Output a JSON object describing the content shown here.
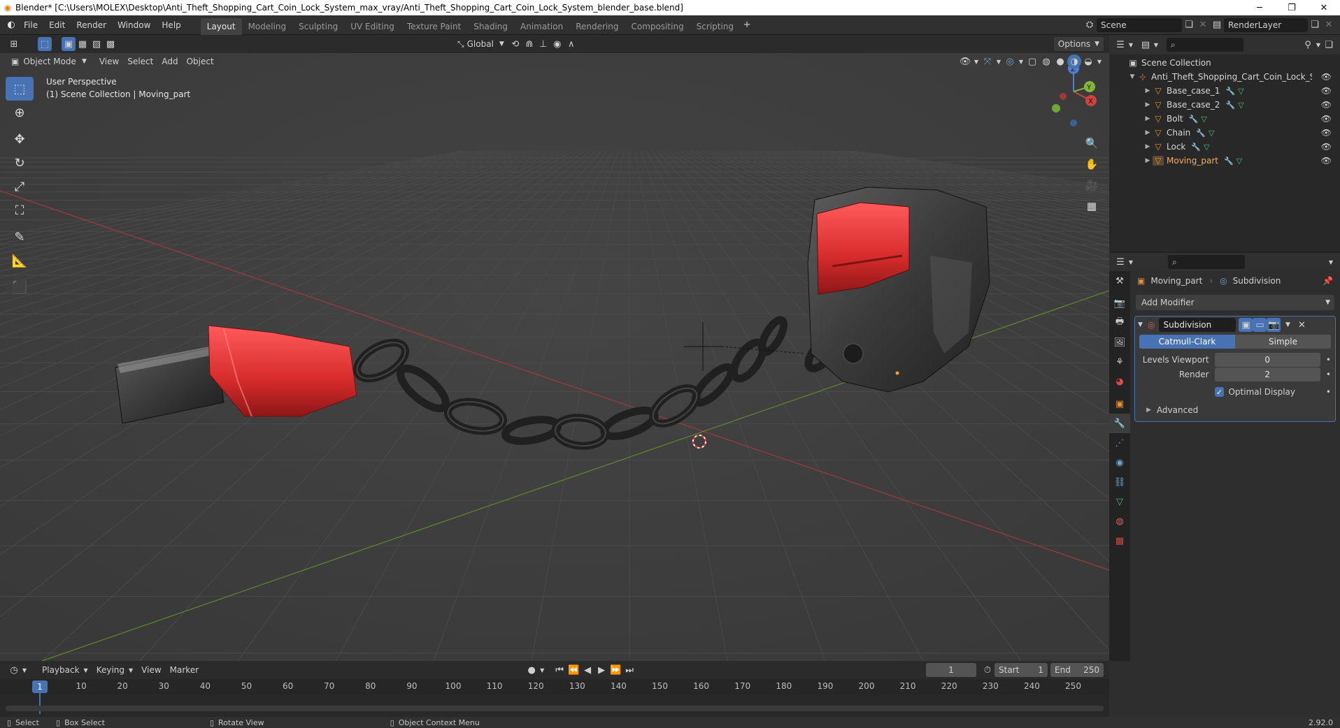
{
  "window": {
    "title": "Blender* [C:\\Users\\MOLEX\\Desktop\\Anti_Theft_Shopping_Cart_Coin_Lock_System_max_vray/Anti_Theft_Shopping_Cart_Coin_Lock_System_blender_base.blend]",
    "controls": [
      "─",
      "❐",
      "✕"
    ]
  },
  "menu": [
    "File",
    "Edit",
    "Render",
    "Window",
    "Help"
  ],
  "workspaces": [
    "Layout",
    "Modeling",
    "Sculpting",
    "UV Editing",
    "Texture Paint",
    "Shading",
    "Animation",
    "Rendering",
    "Compositing",
    "Scripting"
  ],
  "active_workspace": "Layout",
  "scene_field": "Scene",
  "renderlayer_field": "RenderLayer",
  "viewport": {
    "mode": "Object Mode",
    "menus": [
      "View",
      "Select",
      "Add",
      "Object"
    ],
    "transform_orientation": "Global",
    "options_label": "Options",
    "info_line1": "User Perspective",
    "info_line2": "(1) Scene Collection | Moving_part",
    "gizmo_axes": {
      "x": "X",
      "y": "Y",
      "z": "Z"
    }
  },
  "outliner": {
    "root": "Scene Collection",
    "collection": "Anti_Theft_Shopping_Cart_Coin_Lock_Syster",
    "objects": [
      "Base_case_1",
      "Base_case_2",
      "Bolt",
      "Chain",
      "Lock",
      "Moving_part"
    ]
  },
  "properties": {
    "breadcrumb_object": "Moving_part",
    "breadcrumb_modifier": "Subdivision",
    "add_modifier": "Add Modifier",
    "modifier_name": "Subdivision",
    "mode_catmull": "Catmull-Clark",
    "mode_simple": "Simple",
    "levels_viewport_label": "Levels Viewport",
    "levels_viewport_value": "0",
    "render_label": "Render",
    "render_value": "2",
    "optimal_display_label": "Optimal Display",
    "optimal_display_checked": true,
    "advanced_label": "Advanced"
  },
  "timeline": {
    "menus": [
      "Playback",
      "Keying",
      "View",
      "Marker"
    ],
    "current_frame": "1",
    "start_label": "Start",
    "start_value": "1",
    "end_label": "End",
    "end_value": "250",
    "ruler": [
      "10",
      "20",
      "30",
      "40",
      "50",
      "60",
      "70",
      "80",
      "90",
      "100",
      "110",
      "120",
      "130",
      "140",
      "150",
      "160",
      "170",
      "180",
      "190",
      "200",
      "210",
      "220",
      "230",
      "240",
      "250"
    ],
    "playhead_label": "1"
  },
  "statusbar": {
    "select": "Select",
    "box_select": "Box Select",
    "rotate_view": "Rotate View",
    "context_menu": "Object Context Menu",
    "version": "2.92.0"
  }
}
